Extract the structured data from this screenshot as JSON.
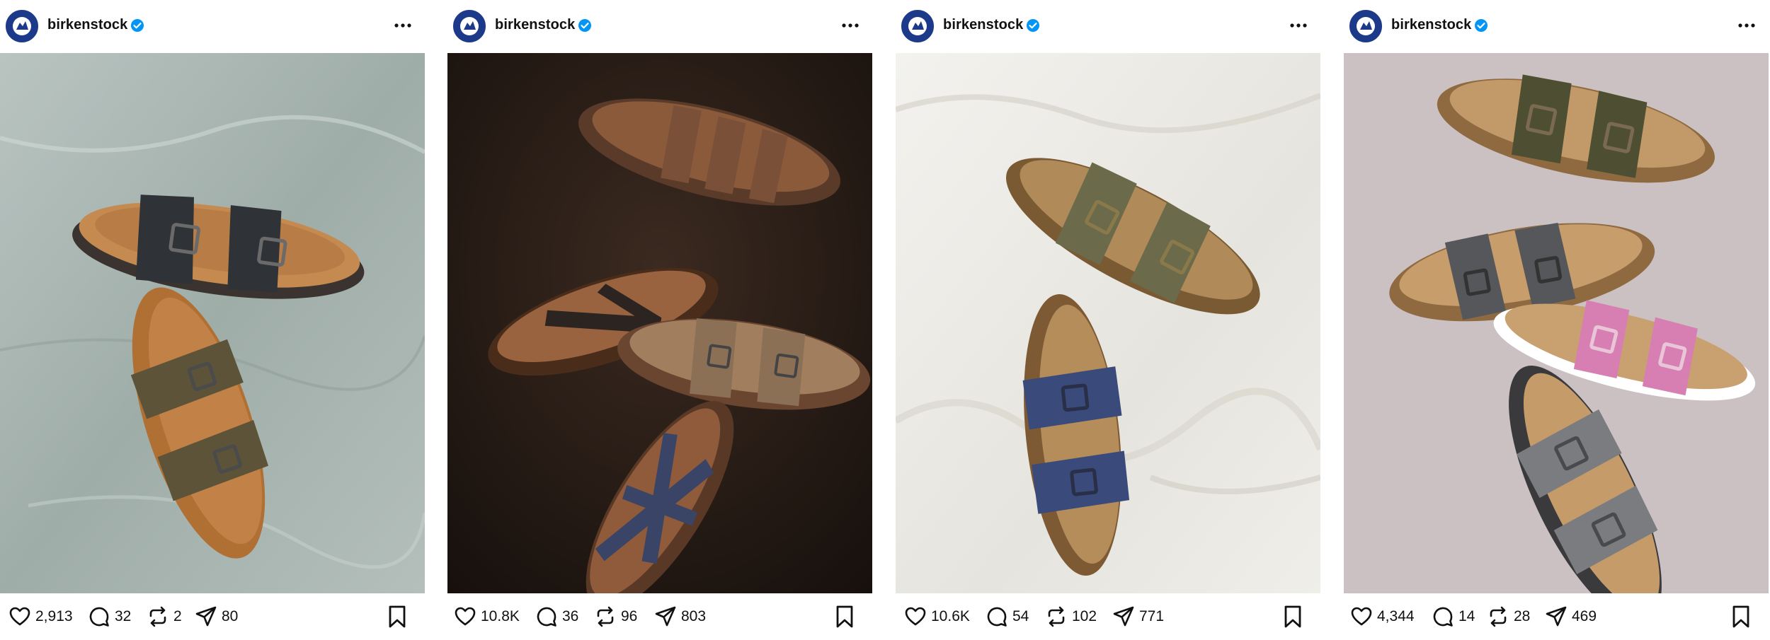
{
  "posts": [
    {
      "username": "birkenstock",
      "likes": "2,913",
      "comments": "32",
      "reposts": "2",
      "shares": "80",
      "photo_background": "#a7b3ae"
    },
    {
      "username": "birkenstock",
      "likes": "10.8K",
      "comments": "36",
      "reposts": "96",
      "shares": "803",
      "photo_background": "#2a1d16"
    },
    {
      "username": "birkenstock",
      "likes": "10.6K",
      "comments": "54",
      "reposts": "102",
      "shares": "771",
      "photo_background": "#ecebe7"
    },
    {
      "username": "birkenstock",
      "likes": "4,344",
      "comments": "14",
      "reposts": "28",
      "shares": "469",
      "photo_background": "#c9bfc0"
    }
  ],
  "icons": {
    "avatar": "birkenstock-logo",
    "verified": "verified-badge-icon",
    "more": "more-options-icon",
    "like": "heart-icon",
    "comment": "comment-icon",
    "repost": "repost-icon",
    "share": "send-icon",
    "bookmark": "bookmark-icon"
  },
  "colors": {
    "verified": "#0095f6",
    "brand_blue": "#1d3a8a"
  }
}
